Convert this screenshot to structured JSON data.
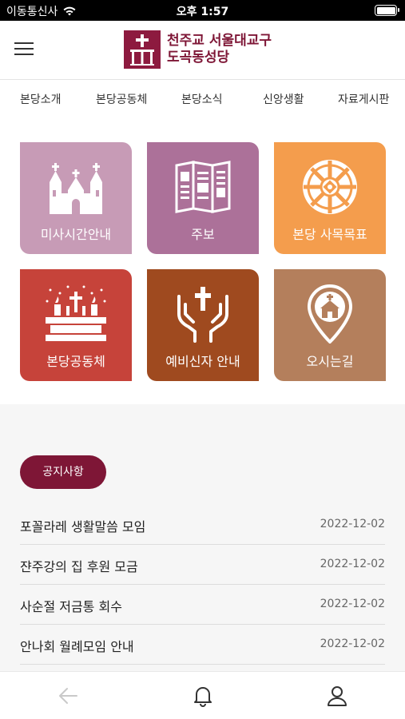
{
  "status_bar": {
    "carrier": "이동통신사",
    "time": "오후 1:57"
  },
  "header": {
    "logo_line1": "천주교 서울대교구",
    "logo_line2": "도곡동성당"
  },
  "nav": {
    "items": [
      "본당소개",
      "본당공동체",
      "본당소식",
      "신앙생활",
      "자료게시판"
    ]
  },
  "tiles": [
    {
      "label": "미사시간안내",
      "icon": "church-icon",
      "color": "#c79bb6"
    },
    {
      "label": "주보",
      "icon": "bulletin-icon",
      "color": "#ac7199"
    },
    {
      "label": "본당 사목목표",
      "icon": "rose-window-icon",
      "color": "#f49d4d"
    },
    {
      "label": "본당공동체",
      "icon": "altar-candles-icon",
      "color": "#c6433a"
    },
    {
      "label": "예비신자 안내",
      "icon": "hands-cross-icon",
      "color": "#9f4a1f"
    },
    {
      "label": "오시는길",
      "icon": "location-church-icon",
      "color": "#b47f5c"
    }
  ],
  "notices": {
    "button_label": "공지사항",
    "items": [
      {
        "title": "포꼴라레 생활말씀 모임",
        "date": "2022-12-02"
      },
      {
        "title": "쟌주강의 집 후원 모금",
        "date": "2022-12-02"
      },
      {
        "title": "사순절 저금통 회수",
        "date": "2022-12-02"
      },
      {
        "title": "안나회 월례모임 안내",
        "date": "2022-12-02"
      }
    ]
  },
  "bottom_bar": {
    "items": [
      "back-arrow-icon",
      "bell-icon",
      "user-icon"
    ]
  },
  "colors": {
    "brand": "#7e1636",
    "brand_logo": "#8d1a3f"
  }
}
